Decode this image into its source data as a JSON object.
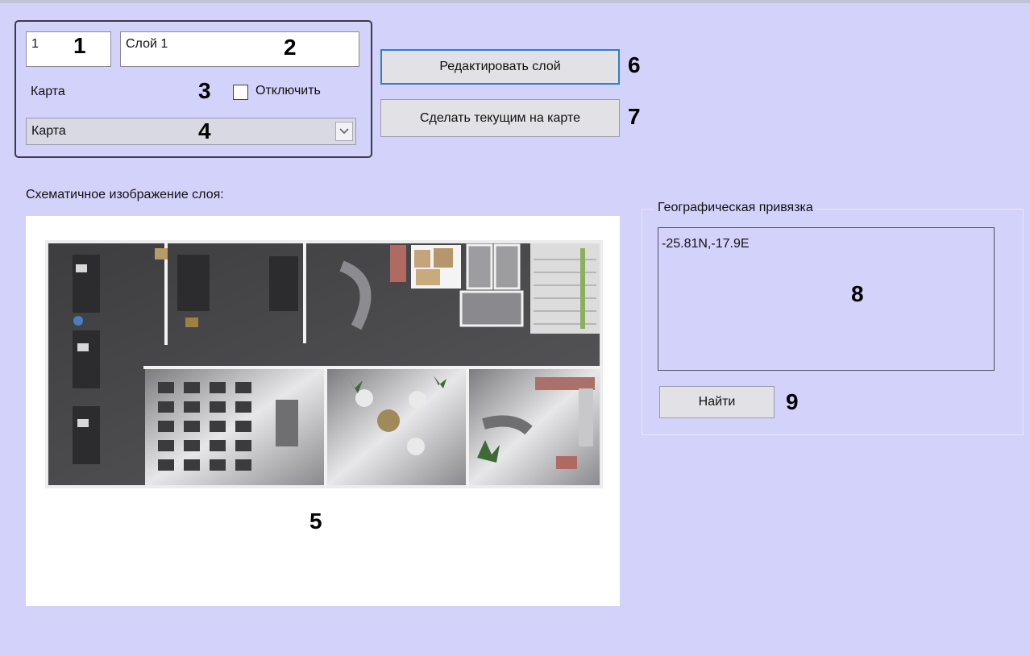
{
  "layer_id": "1",
  "layer_name": "Слой 1",
  "map_label": "Карта",
  "disable_label": "Отключить",
  "disable_checked": false,
  "map_select": {
    "selected": "Карта"
  },
  "buttons": {
    "edit_layer": "Редактировать слой",
    "make_current": "Сделать текущим на карте",
    "find": "Найти"
  },
  "schematic_label": "Схематичное изображение слоя:",
  "geo": {
    "title": "Географическая привязка",
    "coords": "-25.81N,-17.9E"
  },
  "markers": [
    "1",
    "2",
    "3",
    "4",
    "5",
    "6",
    "7",
    "8",
    "9"
  ],
  "colors": {
    "background": "#d3d2fb",
    "focus_border": "#2d7fd0",
    "floor": "#4a4a4d",
    "wall": "#f2f2f2"
  },
  "icons": {
    "combo_arrow": "chevron-down-icon",
    "floor_plan": "office-floor-plan-image"
  }
}
